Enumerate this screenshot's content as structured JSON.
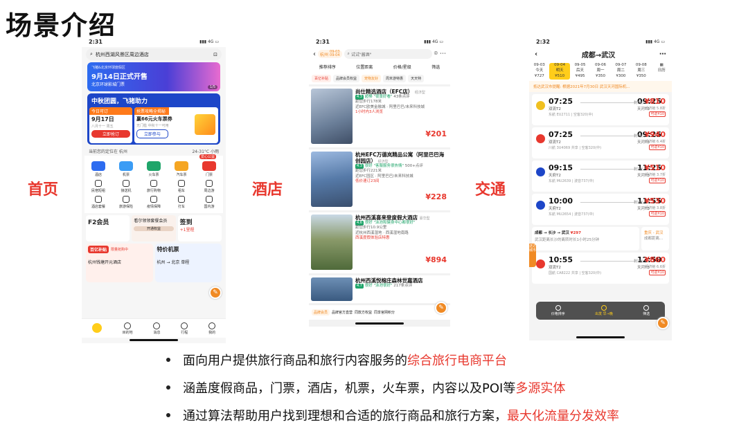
{
  "slide_title": "场景介绍",
  "labels": {
    "home": "首页",
    "hotel": "酒店",
    "transport": "交通"
  },
  "phone1": {
    "time": "2:31",
    "signal": "4G",
    "search_text": "杭州西湖风景区周边酒店",
    "banner1": {
      "small": "飞猪&北京环球度假区",
      "title": "9月14日正式开售",
      "sub": "北京环球影城门票",
      "pager": "1/5"
    },
    "banner2": {
      "title": "中秋团圆，飞猪助力",
      "card1": {
        "head": "今日可订",
        "date": "9月17日",
        "sub": "八月十一  周五",
        "button": "立即抢订"
      },
      "card2": {
        "head": "抢票攻略全揭秘",
        "title": "赢66元火车票券",
        "sub": "无门槛 中秋十一可用",
        "button": "立即参与"
      }
    },
    "location": "当前您的定位在  杭州",
    "weather": "24-31°C  小雨",
    "row1_badge": "爱心公益",
    "icons_row1": [
      "酒店",
      "机票",
      "火车票",
      "汽车票",
      "门票"
    ],
    "icons_row2": [
      "民宿短租",
      "接送机",
      "旅行购物",
      "租车",
      "周边游"
    ],
    "icons_row3": [
      "酒店套餐",
      "旅游保险",
      "疫情保障",
      "打车",
      "国内游"
    ],
    "member": {
      "title": "F2会员",
      "mid": "看尔领领套餐会员",
      "mid_btn": "开通权益",
      "sign": "签到",
      "sign_sub": "+1里程"
    },
    "promo1": {
      "title": "百亿补贴",
      "tag": "限量抢购中",
      "text": "杭州钱塘开元酒店"
    },
    "promo2": {
      "title": "特价机票",
      "text": "杭州 → 北京 单程"
    },
    "tabs": [
      "飞猪",
      "目的地",
      "消息",
      "行程",
      "我的"
    ]
  },
  "phone2": {
    "time": "2:31",
    "signal": "4G",
    "city": "杭州",
    "dates": [
      "09-03",
      "09-04"
    ],
    "search_placeholder": "试试\"酱酒\"",
    "filters": [
      "推荐排序",
      "位置距离",
      "价格/星级",
      "筛选"
    ],
    "tags": [
      "百亿补贴",
      "品牌会员权益",
      "宠物友好",
      "周末游特惠",
      "天天特"
    ],
    "hotels": [
      {
        "name": "尚仕精选酒店（EFC店）",
        "type": "经济型",
        "score": "4.3",
        "review": "超棒 \"夜景好看\"",
        "count": "43条点评",
        "dist": "距您步行178米",
        "area": "近EFC欧美金融城 · 阿里巴巴/未来科技城",
        "promo": "1小时内3人浏览",
        "price": "¥201"
      },
      {
        "name": "杭州EFC万德岚精品公寓（阿里巴巴海创园店）",
        "type": "经济型",
        "score": "4.3",
        "review": "很好 \"客服服务很热情\"",
        "count": "500+点评",
        "dist": "距您步行221米",
        "area": "近EFC园区 · 阿里巴巴/未来科技城",
        "promo": "低价速订23间",
        "price": "¥228"
      },
      {
        "name": "杭州西溪喜来登度假大酒店",
        "type": "豪华型",
        "score": "4.6",
        "review": "很好 \"泳池和健身中心都很好\"",
        "count": "",
        "dist": "距您步行10.9公里",
        "area": "近杭州西溪湿地 · 西溪湿地南路",
        "promo": "西溪度假体验店特惠",
        "price": "¥894"
      },
      {
        "name": "杭州西溪悦榕庄森林世嘉酒店",
        "type": "",
        "score": "4.7",
        "review": "很好 \"泳池很好\"",
        "count": "217条点评",
        "dist": "",
        "area": "",
        "promo": "",
        "price": ""
      }
    ],
    "bottom_tags": [
      "品牌会员",
      "品牌官方直营",
      "同款方权益",
      "同享官网积分"
    ]
  },
  "phone3": {
    "time": "2:32",
    "signal": "4G",
    "route": "成都→武汉",
    "dates": [
      {
        "d": "09-03",
        "w": "今天",
        "p": "¥727"
      },
      {
        "d": "09-04",
        "w": "明天",
        "p": "¥510",
        "sel": true
      },
      {
        "d": "09-05",
        "w": "后天",
        "p": "¥495"
      },
      {
        "d": "09-06",
        "w": "周一",
        "p": "¥350"
      },
      {
        "d": "09-07",
        "w": "周二",
        "p": "¥300"
      },
      {
        "d": "09-08",
        "w": "周三",
        "p": "¥350"
      }
    ],
    "calendar_label": "日历",
    "notice": "抵达武汉市提醒: 根据2021年7月30日 武汉天河国际机...",
    "flights": [
      {
        "dep": "07:25",
        "arr": "09:25",
        "from": "双流T2",
        "to": "天河T3",
        "sub": "东航 EU2711 | 空客320(中)",
        "price": "¥810",
        "disc": "经济舱 5.8折",
        "tag": "剩1张",
        "rt": "可返¥10",
        "color": "#f0c020"
      },
      {
        "dep": "07:25",
        "arr": "09:25",
        "from": "双流T2",
        "to": "天河T3",
        "sub": "川航 3U4069 共享 | 空客320(中)",
        "price": "¥940",
        "disc": "经济舱 6.4折",
        "tag": "剩1张",
        "rt": "可返¥10",
        "color": "#e8382e"
      },
      {
        "dep": "09:15",
        "arr": "11:25",
        "from": "天府T2",
        "to": "天河T3",
        "sub": "东航 MU2639 | 波音737(中)",
        "price": "¥510",
        "disc": "经济舱 3.7折",
        "tag": "剩1张",
        "rt": "可返¥10",
        "color": "#1d46c8"
      },
      {
        "dep": "10:00",
        "arr": "11:55",
        "from": "天府T2",
        "to": "天河T3",
        "sub": "东航 MU2654 | 波音737(中)",
        "price": "¥530",
        "disc": "经济舱 3.8折",
        "tag": "剩1张",
        "rt": "可返¥10",
        "color": "#1d46c8"
      },
      {
        "dep": "10:55",
        "arr": "12:50",
        "from": "双流T2",
        "to": "天河T3",
        "sub": "国航 CA8222 共享 | 空客320(中)",
        "price": "¥860",
        "disc": "经济舱 6.6折",
        "tag": "剩1张",
        "rt": "可返¥10",
        "color": "#e8382e"
      }
    ],
    "transfer": {
      "route": "成都 → 长沙 → 武汉",
      "price": "¥297",
      "sub": "武汉距离长沙的离转时长1小时25分钟",
      "alt": "重庆 - 武汉",
      "alt_sub": "成都距离..."
    },
    "side_tag": "送达城市",
    "float_bar": [
      "价格排序",
      "出发 早→晚",
      "筛选"
    ]
  },
  "bullets": [
    {
      "text": "面向用户提供旅行商品和旅行内容服务的",
      "hl": "综合旅行电商平台"
    },
    {
      "text": "涵盖度假商品，门票，酒店，机票，火车票，内容以及POI等",
      "hl": "多源实体"
    },
    {
      "text": "通过算法帮助用户找到理想和合适的旅行商品和旅行方案，",
      "hl": "最大化流量分发效率"
    }
  ]
}
